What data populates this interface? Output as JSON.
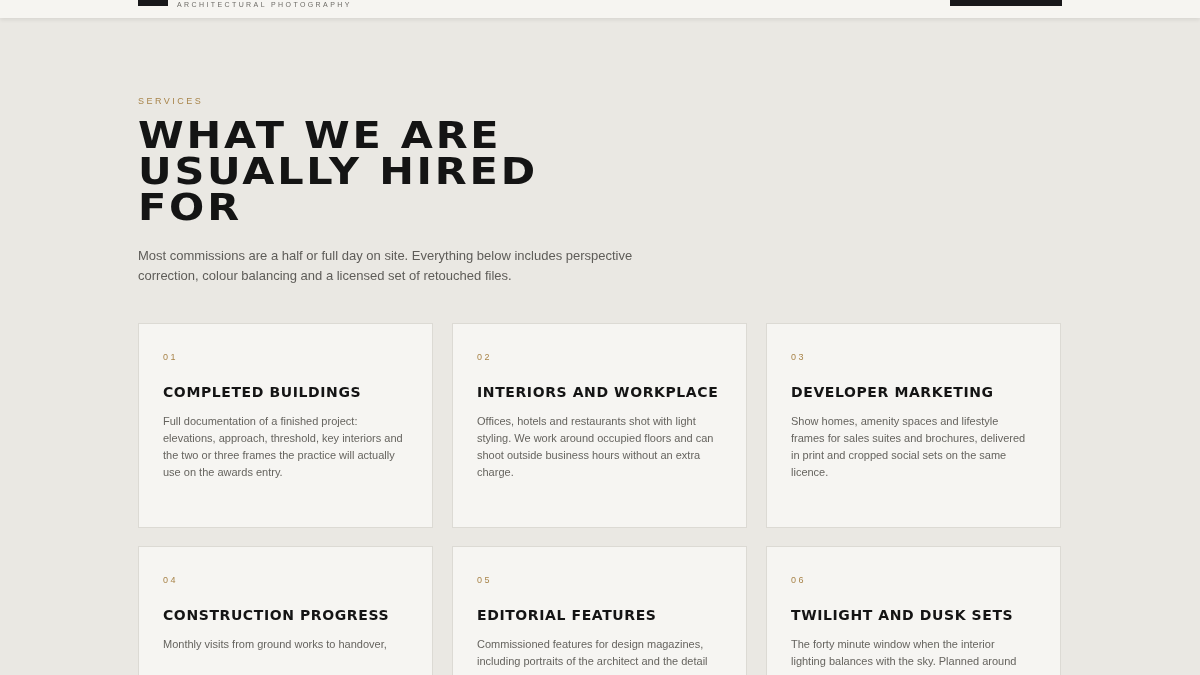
{
  "header": {
    "tagline": "ARCHITECTURAL PHOTOGRAPHY"
  },
  "section": {
    "eyebrow": "SERVICES",
    "title": "WHAT WE ARE USUALLY HIRED FOR",
    "intro": "Most commissions are a half or full day on site. Everything below includes perspective correction, colour balancing and a licensed set of retouched files."
  },
  "services": [
    {
      "number": "01",
      "title": "COMPLETED BUILDINGS",
      "description": "Full documentation of a finished project: elevations, approach, threshold, key interiors and the two or three frames the practice will actually use on the awards entry."
    },
    {
      "number": "02",
      "title": "INTERIORS AND WORKPLACE",
      "description": "Offices, hotels and restaurants shot with light styling. We work around occupied floors and can shoot outside business hours without an extra charge."
    },
    {
      "number": "03",
      "title": "DEVELOPER MARKETING",
      "description": "Show homes, amenity spaces and lifestyle frames for sales suites and brochures, delivered in print and cropped social sets on the same licence."
    },
    {
      "number": "04",
      "title": "CONSTRUCTION PROGRESS",
      "description": "Monthly visits from ground works to handover,"
    },
    {
      "number": "05",
      "title": "EDITORIAL FEATURES",
      "description": "Commissioned features for design magazines, including portraits of the architect and the detail"
    },
    {
      "number": "06",
      "title": "TWILIGHT AND DUSK SETS",
      "description": "The forty minute window when the interior lighting balances with the sky. Planned around"
    }
  ]
}
